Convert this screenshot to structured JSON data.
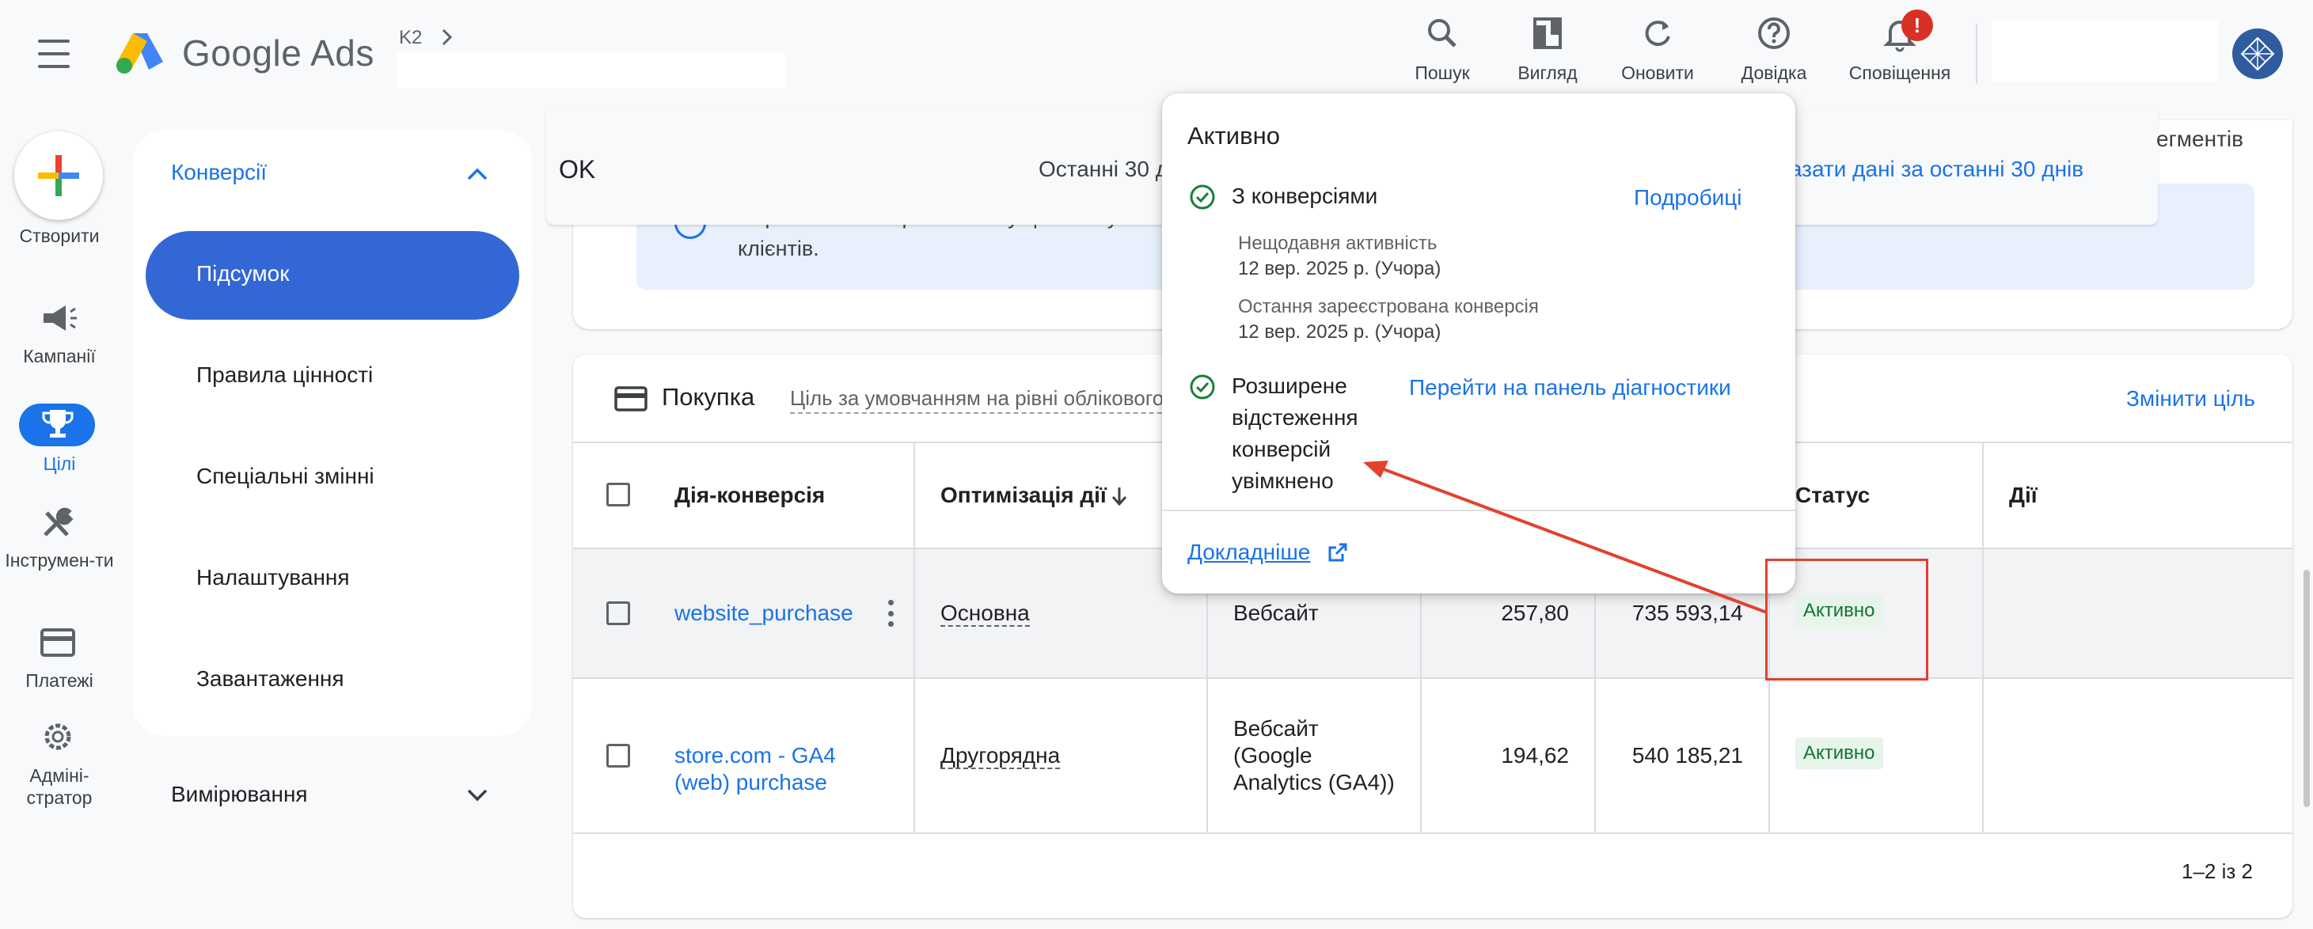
{
  "app": {
    "brand": "Google Ads",
    "breadcrumb": "K2"
  },
  "toolbar": {
    "search": "Пошук",
    "view": "Вигляд",
    "refresh": "Оновити",
    "help": "Довідка",
    "notifications": "Сповіщення",
    "notification_badge": "!"
  },
  "rail": {
    "create": "Створити",
    "campaigns": "Кампанії",
    "goals": "Цілі",
    "tools": "Інструмен-ти",
    "billing": "Платежі",
    "admin": "Адміні-стратор"
  },
  "subnav": {
    "section": "Конверсії",
    "items": [
      "Підсумок",
      "Правила цінності",
      "Спеціальні змінні",
      "Налаштування",
      "Завантаження"
    ],
    "measurement": "Вимірювання"
  },
  "header": {
    "status_text": "OK",
    "date_range": "Останні 30 д",
    "show_last_30": "казати дані за останні 30 днів",
    "segments": "егментів"
  },
  "banner": {
    "text_line1": "Перегляньте запропоновану цінність у...                                                                                                              ина оптимізувати для утримання",
    "text_line2": "клієнтів."
  },
  "goal_card": {
    "title": "Покупка",
    "subtitle": "Ціль за умовчанням на рівні облікового",
    "change_goal": "Змінити ціль",
    "columns": {
      "action": "Дія-конверсія",
      "optimization": "Оптимізація дії",
      "status": "Статус",
      "actions": "Дії"
    },
    "rows": [
      {
        "name": "website_purchase",
        "optimization": "Основна",
        "source": "Вебсайт",
        "conversions": "257,80",
        "value": "735 593,14",
        "status": "Активно"
      },
      {
        "name_line1": "store.com - GA4",
        "name_line2": "(web) purchase",
        "optimization": "Другорядна",
        "source_line1": "Вебсайт",
        "source_line2": "(Google",
        "source_line3": "Analytics (GA4))",
        "conversions": "194,62",
        "value": "540 185,21",
        "status": "Активно"
      }
    ],
    "pagination": "1–2 із 2"
  },
  "popover": {
    "title": "Активно",
    "with_conversions": "З конверсіями",
    "details_link": "Подробиці",
    "recent_activity_label": "Нещодавня активність",
    "recent_activity_date": "12 вер. 2025 р. (Учора)",
    "last_conversion_label": "Остання зареєстрована конверсія",
    "last_conversion_date": "12 вер. 2025 р. (Учора)",
    "enhanced_line1": "Розширене",
    "enhanced_line2": "відстеження",
    "enhanced_line3": "конверсій",
    "enhanced_line4": "увімкнено",
    "diagnostics_link": "Перейти на панель діагностики",
    "learn_more": "Докладніше"
  },
  "colors": {
    "accent": "#1a73e8",
    "active_nav": "#3367d6",
    "status_green": "#137333",
    "status_bg": "#e6f4ea",
    "annotation_red": "#e2412e"
  }
}
